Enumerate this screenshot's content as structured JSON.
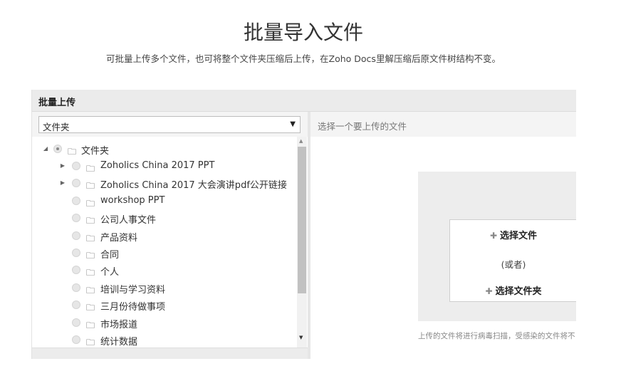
{
  "page": {
    "title": "批量导入文件",
    "subtitle": "可批量上传多个文件，也可将整个文件夹压缩后上传，在Zoho Docs里解压缩后原文件树结构不变。"
  },
  "panel": {
    "header": "批量上传",
    "folder_select": {
      "value": "文件夹"
    },
    "tree": {
      "root": {
        "label": "文件夹",
        "expanded": true,
        "selected": true
      },
      "items": [
        {
          "label": "Zoholics China 2017 PPT",
          "expandable": true
        },
        {
          "label": "Zoholics China 2017 大会演讲pdf公开链接",
          "expandable": true
        },
        {
          "label": "workshop PPT",
          "expandable": false
        },
        {
          "label": "公司人事文件",
          "expandable": false
        },
        {
          "label": "产品资料",
          "expandable": false
        },
        {
          "label": "合同",
          "expandable": false
        },
        {
          "label": "个人",
          "expandable": false
        },
        {
          "label": "培训与学习资料",
          "expandable": false
        },
        {
          "label": "三月份待做事项",
          "expandable": false
        },
        {
          "label": "市场报道",
          "expandable": false
        },
        {
          "label": "统计数据",
          "expandable": false
        }
      ]
    },
    "right": {
      "hint": "选择一个要上传的文件",
      "choose_file": "选择文件",
      "or": "(或者)",
      "choose_folder": "选择文件夹",
      "note": "上传的文件将进行病毒扫描，受感染的文件将不"
    }
  }
}
